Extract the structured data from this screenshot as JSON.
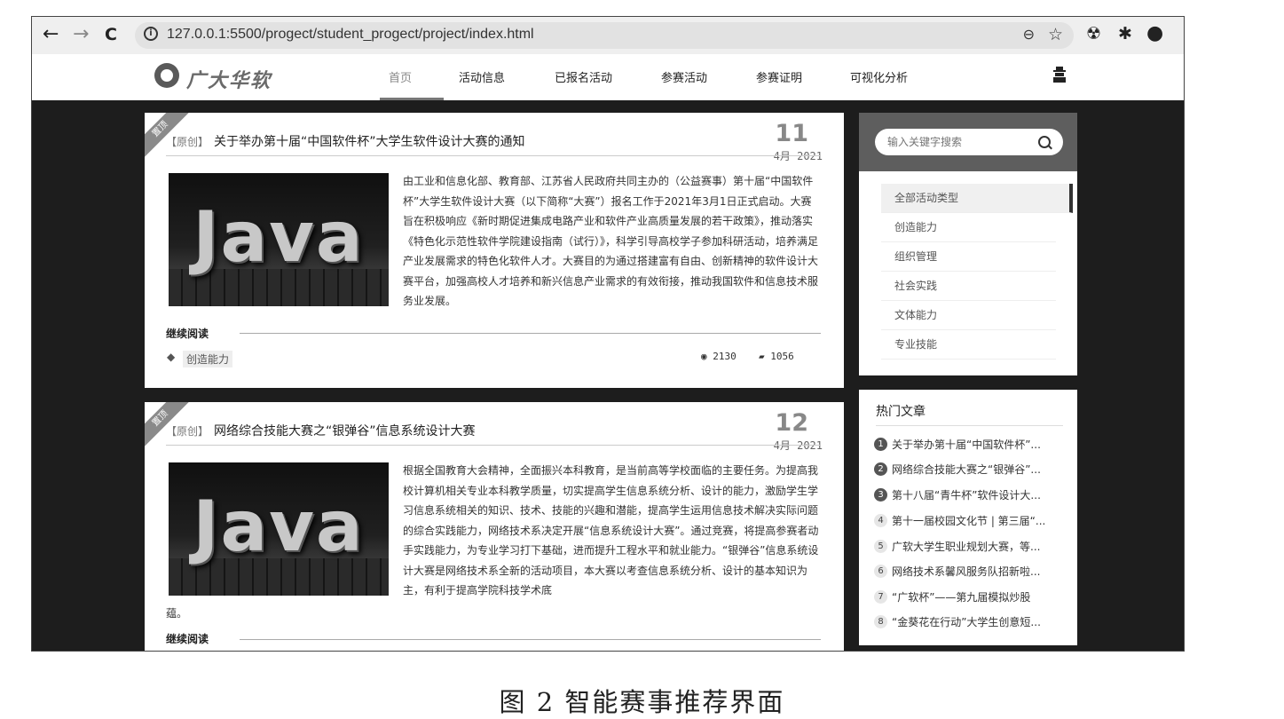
{
  "browser": {
    "url": "127.0.0.1:5500/progect/student_progect/project/index.html",
    "back_icon": "←",
    "forward_icon": "→",
    "reload_icon": "C",
    "zoom_icon": "⊖",
    "star_icon": "☆",
    "ext1_icon": "☢",
    "ext2_icon": "✱",
    "profile_icon": "●"
  },
  "site": {
    "logo_text": "广大华软",
    "nav": [
      {
        "label": "首页"
      },
      {
        "label": "活动信息"
      },
      {
        "label": "已报名活动"
      },
      {
        "label": "参赛活动"
      },
      {
        "label": "参赛证明"
      },
      {
        "label": "可视化分析"
      }
    ]
  },
  "posts": [
    {
      "ribbon": "置顶",
      "tag": "【原创】",
      "title": "关于举办第十届“中国软件杯”大学生软件设计大赛的通知",
      "day": "11",
      "month_year": "4月  2021",
      "thumb_text": "Java",
      "excerpt": "由工业和信息化部、教育部、江苏省人民政府共同主办的（公益赛事）第十届“中国软件杯”大学生软件设计大赛（以下简称“大赛”）报名工作于2021年3月1日正式启动。大赛旨在积极响应《新时期促进集成电路产业和软件产业高质量发展的若干政策》，推动落实《特色化示范性软件学院建设指南（试行）》，科学引导高校学子参加科研活动，培养满足产业发展需求的特色化软件人才。大赛目的为通过搭建富有自由、创新精神的软件设计大赛平台，加强高校人才培养和新兴信息产业需求的有效衔接，推动我国软件和信息技术服务业发展。",
      "continue": "继续阅读",
      "category": "创造能力",
      "views": "2130",
      "comments": "1056"
    },
    {
      "ribbon": "置顶",
      "tag": "【原创】",
      "title": "网络综合技能大赛之“银弹谷”信息系统设计大赛",
      "day": "12",
      "month_year": "4月  2021",
      "thumb_text": "Java",
      "excerpt": "根据全国教育大会精神，全面振兴本科教育，是当前高等学校面临的主要任务。为提高我校计算机相关专业本科教学质量，切实提高学生信息系统分析、设计的能力，激励学生学习信息系统相关的知识、技术、技能的兴趣和潜能，提高学生运用信息技术解决实际问题的综合实践能力，网络技术系决定开展“信息系统设计大赛”。通过竞赛，将提高参赛者动手实践能力，为专业学习打下基础，进而提升工程水平和就业能力。“银弹谷”信息系统设计大赛是网络技术系全新的活动项目，本大赛以考查信息系统分析、设计的基本知识为主，有利于提高学院科技学术底",
      "excerpt_tail": "蕴。",
      "continue": "继续阅读"
    }
  ],
  "sidebar": {
    "search_placeholder": "输入关键字搜索",
    "categories": [
      "全部活动类型",
      "创造能力",
      "组织管理",
      "社会实践",
      "文体能力",
      "专业技能"
    ],
    "hot_title": "热门文章",
    "hot": [
      {
        "num": "1",
        "text": "关于举办第十届“中国软件杯”..."
      },
      {
        "num": "2",
        "text": "网络综合技能大赛之“银弹谷”..."
      },
      {
        "num": "3",
        "text": "第十八届“青牛杯”软件设计大..."
      },
      {
        "num": "4",
        "text": "第十一届校园文化节 | 第三届“..."
      },
      {
        "num": "5",
        "text": "广软大学生职业规划大赛，等..."
      },
      {
        "num": "6",
        "text": "网络技术系馨风服务队招新啦..."
      },
      {
        "num": "7",
        "text": "“广软杯”——第九届模拟炒股"
      },
      {
        "num": "8",
        "text": "“金葵花在行动”大学生创意短..."
      }
    ]
  },
  "caption": "图 2   智能赛事推荐界面"
}
